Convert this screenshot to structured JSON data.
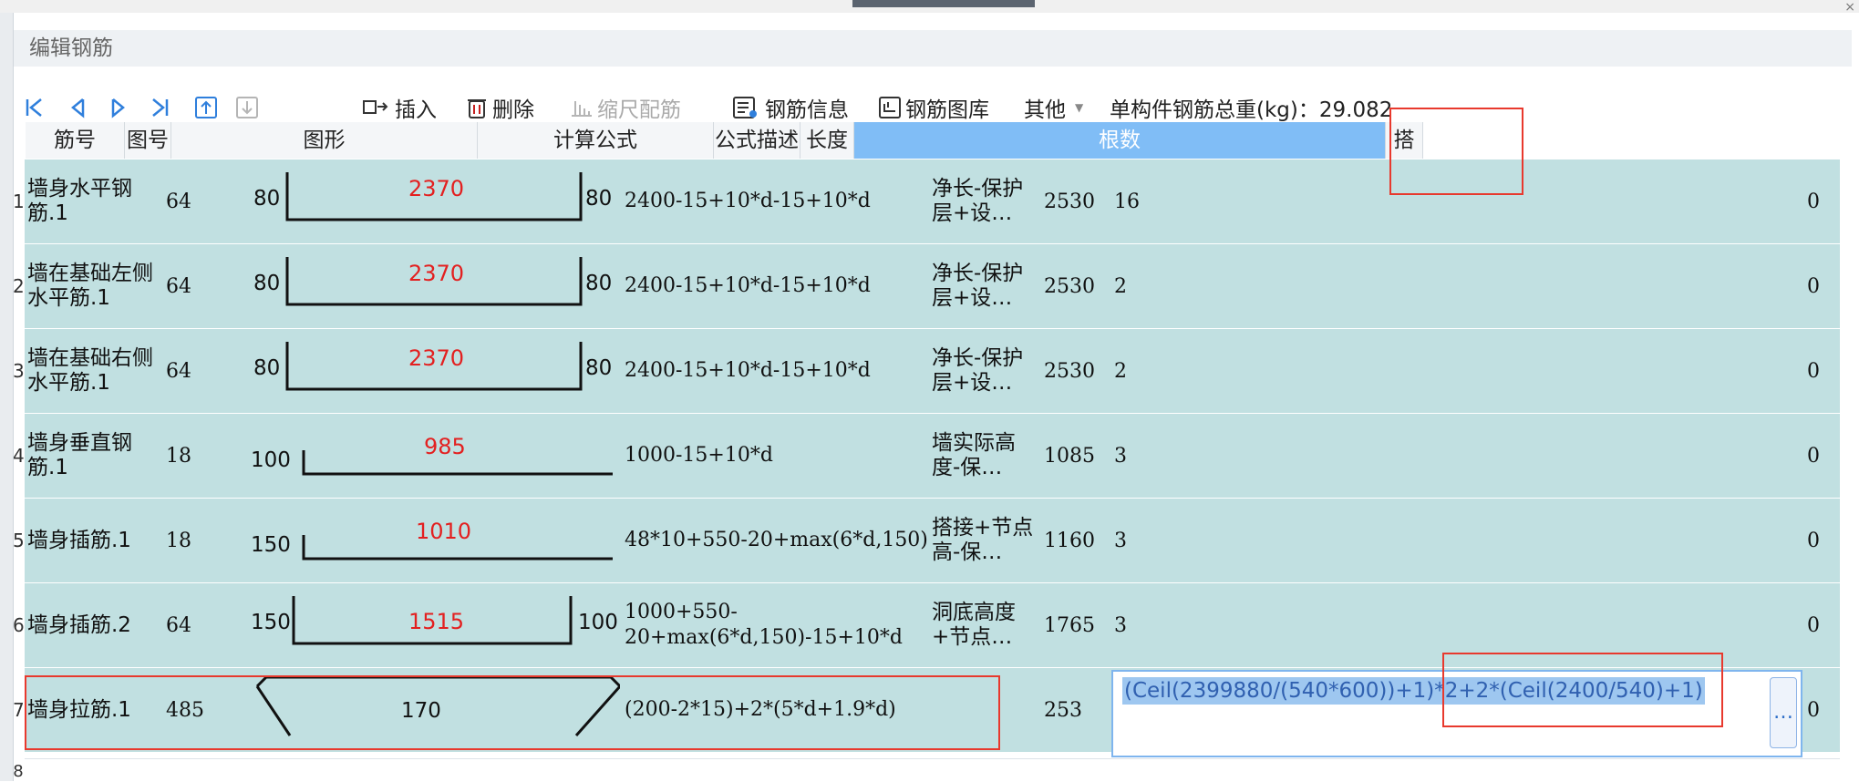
{
  "window": {
    "title": "编辑钢筋"
  },
  "toolbar": {
    "insert_label": "插入",
    "delete_label": "删除",
    "scale_label": "缩尺配筋",
    "info_label": "钢筋信息",
    "library_label": "钢筋图库",
    "other_label": "其他",
    "total_weight_label": "单构件钢筋总重(kg)：29.082"
  },
  "table": {
    "headers": {
      "name": "筋号",
      "fig": "图号",
      "shape": "图形",
      "formula": "计算公式",
      "desc": "公式描述",
      "length": "长度",
      "count": "根数",
      "lap": "搭"
    },
    "rows": [
      {
        "idx": "1",
        "name": "墙身水平钢筋.1",
        "fig": "64",
        "left": "80",
        "mid": "2370",
        "right": "80",
        "formula": "2400-15+10*d-15+10*d",
        "desc": "净长-保护层+设…",
        "length": "2530",
        "count": "16",
        "lap": "0"
      },
      {
        "idx": "2",
        "name": "墙在基础左侧水平筋.1",
        "fig": "64",
        "left": "80",
        "mid": "2370",
        "right": "80",
        "formula": "2400-15+10*d-15+10*d",
        "desc": "净长-保护层+设…",
        "length": "2530",
        "count": "2",
        "lap": "0"
      },
      {
        "idx": "3",
        "name": "墙在基础右侧水平筋.1",
        "fig": "64",
        "left": "80",
        "mid": "2370",
        "right": "80",
        "formula": "2400-15+10*d-15+10*d",
        "desc": "净长-保护层+设…",
        "length": "2530",
        "count": "2",
        "lap": "0"
      },
      {
        "idx": "4",
        "name": "墙身垂直钢筋.1",
        "fig": "18",
        "left": "100",
        "mid": "985",
        "right": "",
        "formula": "1000-15+10*d",
        "desc": "墙实际高度-保…",
        "length": "1085",
        "count": "3",
        "lap": "0"
      },
      {
        "idx": "5",
        "name": "墙身插筋.1",
        "fig": "18",
        "left": "150",
        "mid": "1010",
        "right": "",
        "formula": "48*10+550-20+max(6*d,150)",
        "desc": "搭接+节点高-保…",
        "length": "1160",
        "count": "3",
        "lap": "0"
      },
      {
        "idx": "6",
        "name": "墙身插筋.2",
        "fig": "64",
        "left": "150",
        "mid": "1515",
        "right": "100",
        "formula": "1000+550-20+max(6*d,150)-15+10*d",
        "desc": "洞底高度+节点…",
        "length": "1765",
        "count": "3",
        "lap": "0"
      },
      {
        "idx": "7",
        "name": "墙身拉筋.1",
        "fig": "485",
        "left": "",
        "mid": "170",
        "right": "",
        "formula": "(200-2*15)+2*(5*d+1.9*d)",
        "desc": "",
        "length": "253",
        "count": "(Ceil(2399880/(540*600))+1)*2+2*(Ceil(2400/540)+1)",
        "lap": "0"
      }
    ],
    "next_row_idx": "8",
    "edit_button_label": "…"
  },
  "colors": {
    "row_bg": "#c1e0e1",
    "header_selected": "#80bdf6",
    "highlight_box": "#e8392d",
    "red_text": "#e32020"
  }
}
